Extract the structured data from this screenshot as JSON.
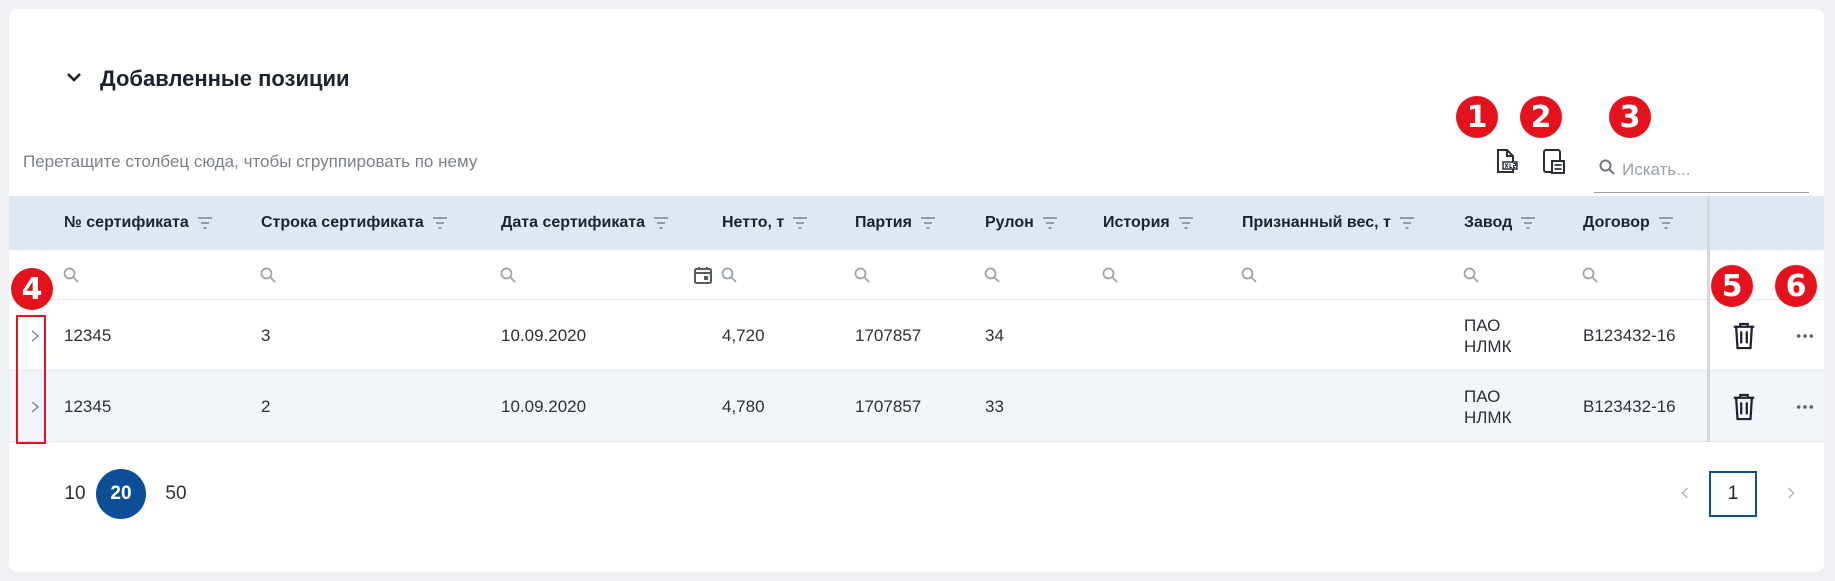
{
  "section": {
    "title": "Добавленные позиции"
  },
  "group_hint": "Перетащите столбец сюда, чтобы сгруппировать по нему",
  "search": {
    "placeholder": "Искать..."
  },
  "badges": [
    "1",
    "2",
    "3",
    "4",
    "5",
    "6"
  ],
  "columns": [
    "№ сертификата",
    "Строка сертификата",
    "Дата сертификата",
    "Нетто, т",
    "Партия",
    "Рулон",
    "История",
    "Признанный вес, т",
    "Завод",
    "Договор"
  ],
  "rows": [
    {
      "cert_no": "12345",
      "cert_line": "3",
      "cert_date": "10.09.2020",
      "net": "4,720",
      "batch": "1707857",
      "roll": "34",
      "history": "",
      "accepted_weight": "",
      "plant_1": "ПАО",
      "plant_2": "НЛМК",
      "contract": "B123432-16"
    },
    {
      "cert_no": "12345",
      "cert_line": "2",
      "cert_date": "10.09.2020",
      "net": "4,780",
      "batch": "1707857",
      "roll": "33",
      "history": "",
      "accepted_weight": "",
      "plant_1": "ПАО",
      "plant_2": "НЛМК",
      "contract": "B123432-16"
    }
  ],
  "pager": {
    "sizes": [
      "10",
      "20",
      "50"
    ],
    "active_size": "20",
    "current_page": "1"
  },
  "icons": {
    "collapse": "chevron-down-icon",
    "export_xls": "xls-export-icon",
    "column_chooser": "column-chooser-icon",
    "search": "search-icon",
    "filter": "filter-icon",
    "calendar": "calendar-icon",
    "expand": "chevron-right-icon",
    "delete": "trash-icon",
    "more": "more-horizontal-icon"
  },
  "colors": {
    "header_bg": "#dfe7f1",
    "accent": "#0c4f97",
    "annotation": "#e3121d"
  }
}
